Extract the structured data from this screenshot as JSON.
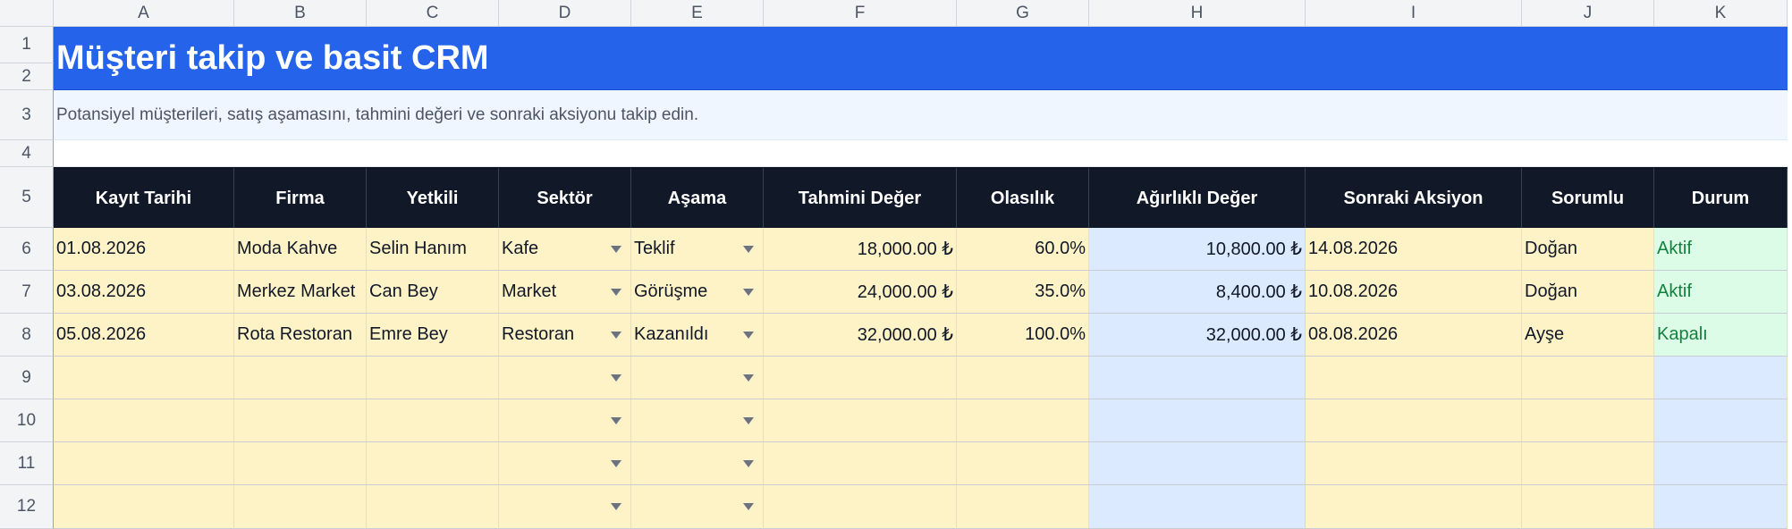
{
  "columns": [
    "A",
    "B",
    "C",
    "D",
    "E",
    "F",
    "G",
    "H",
    "I",
    "J",
    "K"
  ],
  "row_numbers": [
    "1",
    "2",
    "3",
    "4",
    "5",
    "6",
    "7",
    "8",
    "9",
    "10",
    "11",
    "12"
  ],
  "title": "Müşteri takip ve basit CRM",
  "subtitle": "Potansiyel müşterileri, satış aşamasını, tahmini değeri ve sonraki aksiyonu takip edin.",
  "headers": [
    "Kayıt Tarihi",
    "Firma",
    "Yetkili",
    "Sektör",
    "Aşama",
    "Tahmini Değer",
    "Olasılık",
    "Ağırlıklı Değer",
    "Sonraki Aksiyon",
    "Sorumlu",
    "Durum"
  ],
  "rows": [
    [
      "01.08.2026",
      "Moda Kahve",
      "Selin Hanım",
      "Kafe",
      "Teklif",
      "18,000.00 ₺",
      "60.0%",
      "10,800.00 ₺",
      "14.08.2026",
      "Doğan",
      "Aktif"
    ],
    [
      "03.08.2026",
      "Merkez Market",
      "Can Bey",
      "Market",
      "Görüşme",
      "24,000.00 ₺",
      "35.0%",
      "8,400.00 ₺",
      "10.08.2026",
      "Doğan",
      "Aktif"
    ],
    [
      "05.08.2026",
      "Rota Restoran",
      "Emre Bey",
      "Restoran",
      "Kazanıldı",
      "32,000.00 ₺",
      "100.0%",
      "32,000.00 ₺",
      "08.08.2026",
      "Ayşe",
      "Kapalı"
    ]
  ],
  "empty_row_count": 4,
  "colors": {
    "title_bg": "#2563eb",
    "header_bg": "#111827",
    "input_bg": "#fef3c7",
    "calc_bg": "#dbeafe",
    "status_bg": "#dcfce7",
    "status_text": "#15803d"
  }
}
